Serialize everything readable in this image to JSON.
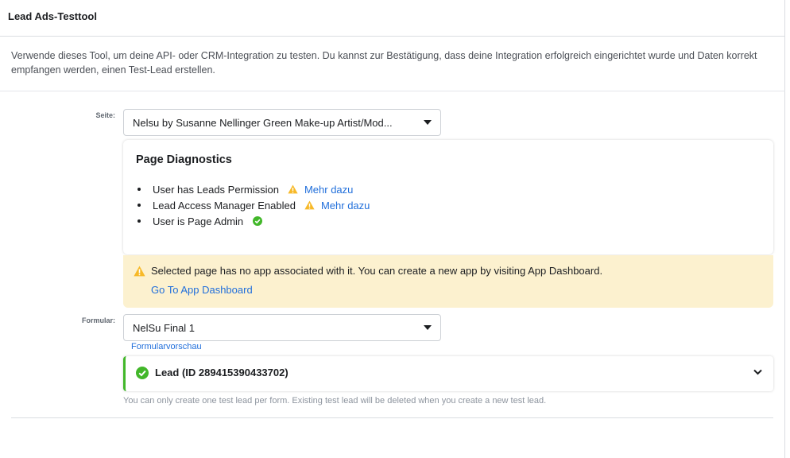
{
  "header": {
    "title": "Lead Ads-Testtool"
  },
  "intro": {
    "text": "Verwende dieses Tool, um deine API- oder CRM-Integration zu testen. Du kannst zur Bestätigung, dass deine Integration erfolgreich eingerichtet wurde und Daten korrekt empfangen werden, einen Test-Lead erstellen."
  },
  "page_field": {
    "label": "Seite:",
    "selected": "Nelsu by Susanne Nellinger Green Make-up Artist/Mod..."
  },
  "diagnostics": {
    "title": "Page Diagnostics",
    "items": [
      {
        "label": "User has Leads Permission",
        "status": "warning",
        "link": "Mehr dazu"
      },
      {
        "label": "Lead Access Manager Enabled",
        "status": "warning",
        "link": "Mehr dazu"
      },
      {
        "label": "User is Page Admin",
        "status": "ok",
        "link": ""
      }
    ]
  },
  "notice": {
    "text": "Selected page has no app associated with it. You can create a new app by visiting App Dashboard.",
    "link": "Go To App Dashboard"
  },
  "form_field": {
    "label": "Formular:",
    "selected": "NelSu Final 1",
    "preview_link": "Formularvorschau"
  },
  "lead": {
    "label": "Lead (ID 289415390433702)"
  },
  "footnote": "You can only create one test lead per form. Existing test lead will be deleted when you create a new test lead.",
  "colors": {
    "link": "#216fdb",
    "warning": "#f7b928",
    "success": "#42b72a",
    "notice_bg": "#fcf1cf"
  }
}
